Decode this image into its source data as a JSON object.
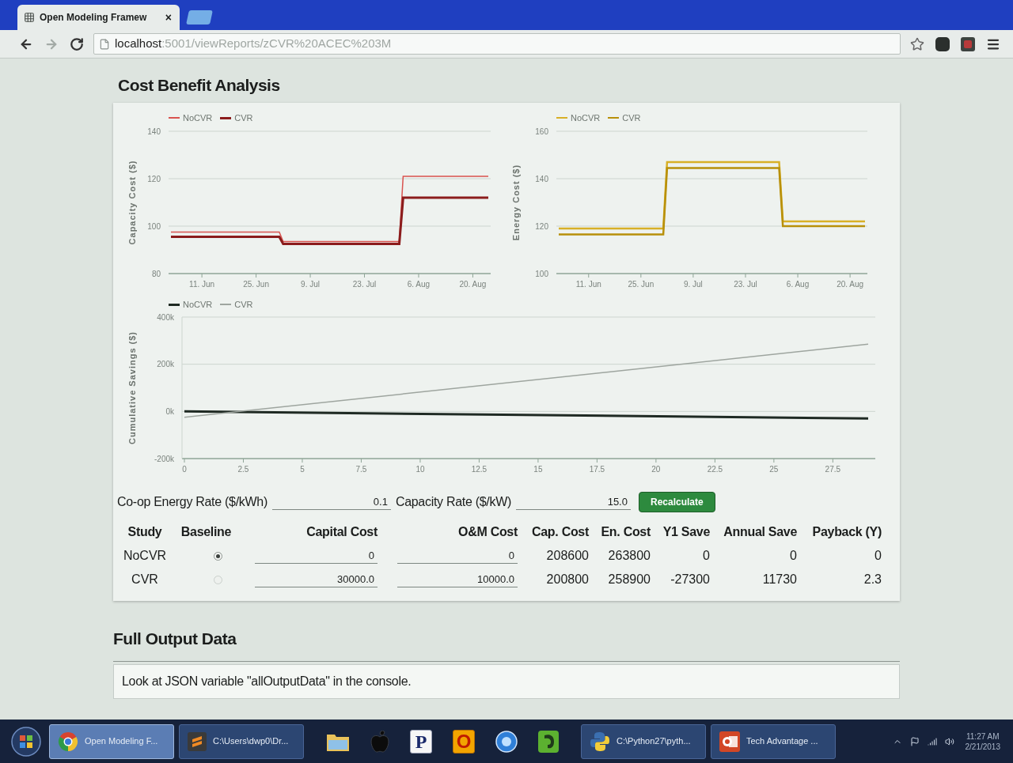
{
  "browser": {
    "tabs": [
      {
        "title": "Open Modeling Framew",
        "close": "×",
        "selected": true
      }
    ],
    "address": {
      "host": "localhost",
      "path": ":5001/viewReports/zCVR%20ACEC%203M"
    }
  },
  "cost_benefit": {
    "title": "Cost Benefit Analysis",
    "charts": [
      {
        "chart_data": {
          "type": "line",
          "ylabel": "Capacity Cost ($)",
          "legend": "top",
          "categories": [
            null,
            null,
            null,
            null,
            null,
            null,
            null,
            null,
            "11. Jun",
            null,
            null,
            null,
            null,
            null,
            null,
            null,
            null,
            null,
            null,
            null,
            null,
            null,
            "25. Jun",
            null,
            null,
            null,
            null,
            null,
            null,
            null,
            null,
            null,
            null,
            null,
            null,
            null,
            "9. Jul",
            null,
            null,
            null,
            null,
            null,
            null,
            null,
            null,
            null,
            null,
            null,
            null,
            null,
            "23. Jul",
            null,
            null,
            null,
            null,
            null,
            null,
            null,
            null,
            null,
            null,
            null,
            null,
            null,
            "6. Aug",
            null,
            null,
            null,
            null,
            null,
            null,
            null,
            null,
            null,
            null,
            null,
            null,
            null,
            "20. Aug",
            null,
            null,
            null,
            null
          ],
          "ylim": [
            80,
            140
          ],
          "yticks": [
            80,
            100,
            120,
            140
          ],
          "series": [
            {
              "name": "NoCVR",
              "color": "#d9534f",
              "values": [
                97.5,
                97.5,
                97.5,
                97.5,
                97.5,
                97.5,
                97.5,
                97.5,
                97.5,
                97.5,
                97.5,
                97.5,
                97.5,
                97.5,
                97.5,
                97.5,
                97.5,
                97.5,
                97.5,
                97.5,
                97.5,
                97.5,
                97.5,
                97.5,
                97.5,
                97.5,
                97.5,
                97.5,
                97.5,
                93.5,
                93.5,
                93.5,
                93.5,
                93.5,
                93.5,
                93.5,
                93.5,
                93.5,
                93.5,
                93.5,
                93.5,
                93.5,
                93.5,
                93.5,
                93.5,
                93.5,
                93.5,
                93.5,
                93.5,
                93.5,
                93.5,
                93.5,
                93.5,
                93.5,
                93.5,
                93.5,
                93.5,
                93.5,
                93.5,
                93.5,
                121,
                121,
                121,
                121,
                121,
                121,
                121,
                121,
                121,
                121,
                121,
                121,
                121,
                121,
                121,
                121,
                121,
                121,
                121,
                121,
                121,
                121,
                121
              ]
            },
            {
              "name": "CVR",
              "color": "#8b1c1c",
              "values": [
                95.5,
                95.5,
                95.5,
                95.5,
                95.5,
                95.5,
                95.5,
                95.5,
                95.5,
                95.5,
                95.5,
                95.5,
                95.5,
                95.5,
                95.5,
                95.5,
                95.5,
                95.5,
                95.5,
                95.5,
                95.5,
                95.5,
                95.5,
                95.5,
                95.5,
                95.5,
                95.5,
                95.5,
                95.5,
                92.5,
                92.5,
                92.5,
                92.5,
                92.5,
                92.5,
                92.5,
                92.5,
                92.5,
                92.5,
                92.5,
                92.5,
                92.5,
                92.5,
                92.5,
                92.5,
                92.5,
                92.5,
                92.5,
                92.5,
                92.5,
                92.5,
                92.5,
                92.5,
                92.5,
                92.5,
                92.5,
                92.5,
                92.5,
                92.5,
                92.5,
                112,
                112,
                112,
                112,
                112,
                112,
                112,
                112,
                112,
                112,
                112,
                112,
                112,
                112,
                112,
                112,
                112,
                112,
                112,
                112,
                112,
                112,
                112
              ]
            }
          ]
        }
      },
      {
        "chart_data": {
          "type": "line",
          "ylabel": "Energy Cost ($)",
          "legend": "top",
          "categories": [
            null,
            null,
            null,
            null,
            null,
            null,
            null,
            null,
            "11. Jun",
            null,
            null,
            null,
            null,
            null,
            null,
            null,
            null,
            null,
            null,
            null,
            null,
            null,
            "25. Jun",
            null,
            null,
            null,
            null,
            null,
            null,
            null,
            null,
            null,
            null,
            null,
            null,
            null,
            "9. Jul",
            null,
            null,
            null,
            null,
            null,
            null,
            null,
            null,
            null,
            null,
            null,
            null,
            null,
            "23. Jul",
            null,
            null,
            null,
            null,
            null,
            null,
            null,
            null,
            null,
            null,
            null,
            null,
            null,
            "6. Aug",
            null,
            null,
            null,
            null,
            null,
            null,
            null,
            null,
            null,
            null,
            null,
            null,
            null,
            "20. Aug",
            null,
            null,
            null,
            null
          ],
          "ylim": [
            100,
            160
          ],
          "yticks": [
            100,
            120,
            140,
            160
          ],
          "series": [
            {
              "name": "NoCVR",
              "color": "#d8b027",
              "values": [
                119,
                119,
                119,
                119,
                119,
                119,
                119,
                119,
                119,
                119,
                119,
                119,
                119,
                119,
                119,
                119,
                119,
                119,
                119,
                119,
                119,
                119,
                119,
                119,
                119,
                119,
                119,
                119,
                119,
                147,
                147,
                147,
                147,
                147,
                147,
                147,
                147,
                147,
                147,
                147,
                147,
                147,
                147,
                147,
                147,
                147,
                147,
                147,
                147,
                147,
                147,
                147,
                147,
                147,
                147,
                147,
                147,
                147,
                147,
                147,
                122,
                122,
                122,
                122,
                122,
                122,
                122,
                122,
                122,
                122,
                122,
                122,
                122,
                122,
                122,
                122,
                122,
                122,
                122,
                122,
                122,
                122,
                122
              ]
            },
            {
              "name": "CVR",
              "color": "#b8900a",
              "values": [
                116.5,
                116.5,
                116.5,
                116.5,
                116.5,
                116.5,
                116.5,
                116.5,
                116.5,
                116.5,
                116.5,
                116.5,
                116.5,
                116.5,
                116.5,
                116.5,
                116.5,
                116.5,
                116.5,
                116.5,
                116.5,
                116.5,
                116.5,
                116.5,
                116.5,
                116.5,
                116.5,
                116.5,
                116.5,
                144.5,
                144.5,
                144.5,
                144.5,
                144.5,
                144.5,
                144.5,
                144.5,
                144.5,
                144.5,
                144.5,
                144.5,
                144.5,
                144.5,
                144.5,
                144.5,
                144.5,
                144.5,
                144.5,
                144.5,
                144.5,
                144.5,
                144.5,
                144.5,
                144.5,
                144.5,
                144.5,
                144.5,
                144.5,
                144.5,
                144.5,
                120,
                120,
                120,
                120,
                120,
                120,
                120,
                120,
                120,
                120,
                120,
                120,
                120,
                120,
                120,
                120,
                120,
                120,
                120,
                120,
                120,
                120,
                120
              ]
            }
          ]
        }
      },
      {
        "chart_data": {
          "type": "line",
          "ylabel": "Cumulative Savings ($)",
          "legend": "top",
          "x": [
            0,
            29
          ],
          "xlim": [
            0,
            29.2
          ],
          "ylim": [
            -200000,
            400000
          ],
          "xticks": [
            0,
            2.5,
            5,
            7.5,
            10,
            12.5,
            15,
            17.5,
            20,
            22.5,
            25,
            27.5
          ],
          "yticks": [
            {
              "value": -200000,
              "label": "-200k"
            },
            {
              "value": 0,
              "label": "0k"
            },
            {
              "value": 200000,
              "label": "200k"
            },
            {
              "value": 400000,
              "label": "400k"
            }
          ],
          "series": [
            {
              "name": "NoCVR",
              "color": "#1f2a23",
              "values": [
                0,
                -30000
              ]
            },
            {
              "name": "CVR",
              "color": "#9ea59f",
              "values": [
                -25000,
                285000
              ]
            }
          ]
        }
      }
    ],
    "rates": [
      {
        "label": "Co-op Energy Rate ($/kWh)",
        "value": "0.1"
      },
      {
        "label": "Capacity Rate ($/kW)",
        "value": "15.0"
      }
    ],
    "recalculate_button": "Recalculate",
    "table": {
      "columns": [
        {
          "label": "Study",
          "kind": "text"
        },
        {
          "label": "Baseline",
          "kind": "radio"
        },
        {
          "label": "Capital Cost",
          "kind": "input"
        },
        {
          "label": "O&M Cost",
          "kind": "input"
        },
        {
          "label": "Cap. Cost",
          "kind": "text"
        },
        {
          "label": "En. Cost",
          "kind": "text"
        },
        {
          "label": "Y1 Save",
          "kind": "text"
        },
        {
          "label": "Annual Save",
          "kind": "text"
        },
        {
          "label": "Payback (Y)",
          "kind": "text"
        }
      ],
      "rows": [
        {
          "cells": [
            "NoCVR",
            {
              "selected": true
            },
            "0",
            "0",
            "208600",
            "263800",
            "0",
            "0",
            "0"
          ]
        },
        {
          "cells": [
            "CVR",
            {
              "selected": false
            },
            "30000.0",
            "10000.0",
            "200800",
            "258900",
            "-27300",
            "11730",
            "2.3"
          ]
        }
      ]
    }
  },
  "full_output": {
    "title": "Full Output Data",
    "message": "Look at JSON variable \"allOutputData\" in the console."
  },
  "taskbar": {
    "windows": [
      {
        "label": "Open Modeling F...",
        "selected": true
      },
      {
        "label": "C:\\Users\\dwp0\\Dr...",
        "selected": false
      },
      {
        "label": "C:\\Python27\\pyth...",
        "selected": false
      },
      {
        "label": "Tech Advantage ...",
        "selected": false
      }
    ],
    "letter_tiles": [
      "P",
      "O"
    ],
    "clock": {
      "time": "11:27 AM",
      "date": "2/21/2013"
    }
  }
}
